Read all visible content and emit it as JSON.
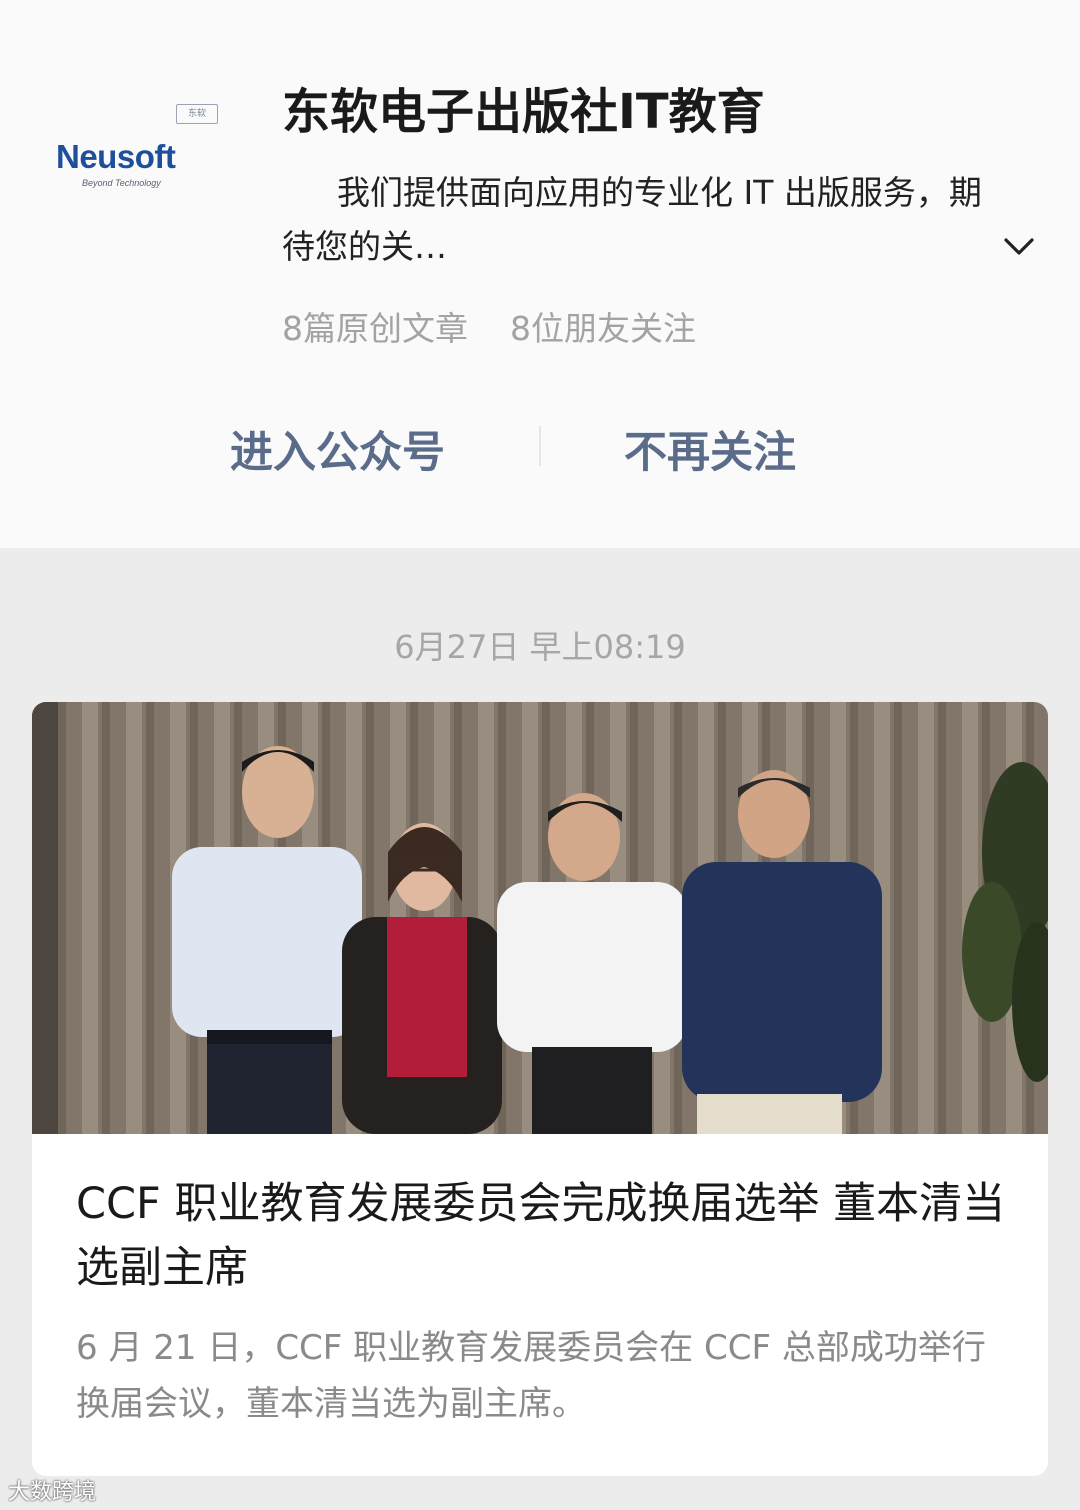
{
  "account": {
    "name": "东软电子出版社IT教育",
    "description": "我们提供面向应用的专业化 IT 出版服务，期待您的关…",
    "logo_text": "Neusoft",
    "logo_subtext": "Beyond Technology",
    "logo_tag": "东软",
    "stats": {
      "original_articles": "8篇原创文章",
      "friends_following": "8位朋友关注"
    },
    "enter_button": "进入公众号",
    "unfollow_button": "不再关注",
    "accent_color": "#5b6c8a"
  },
  "feed": {
    "date_label": "6月27日 早上08:19",
    "article": {
      "title": "CCF 职业教育发展委员会完成换届选举 董本清当选副主席",
      "summary": "6 月 21 日，CCF 职业教育发展委员会在 CCF 总部成功举行换届会议，董本清当选为副主席。"
    }
  },
  "watermark": "大数跨境",
  "icons": {
    "expand": "chevron-down-icon"
  }
}
